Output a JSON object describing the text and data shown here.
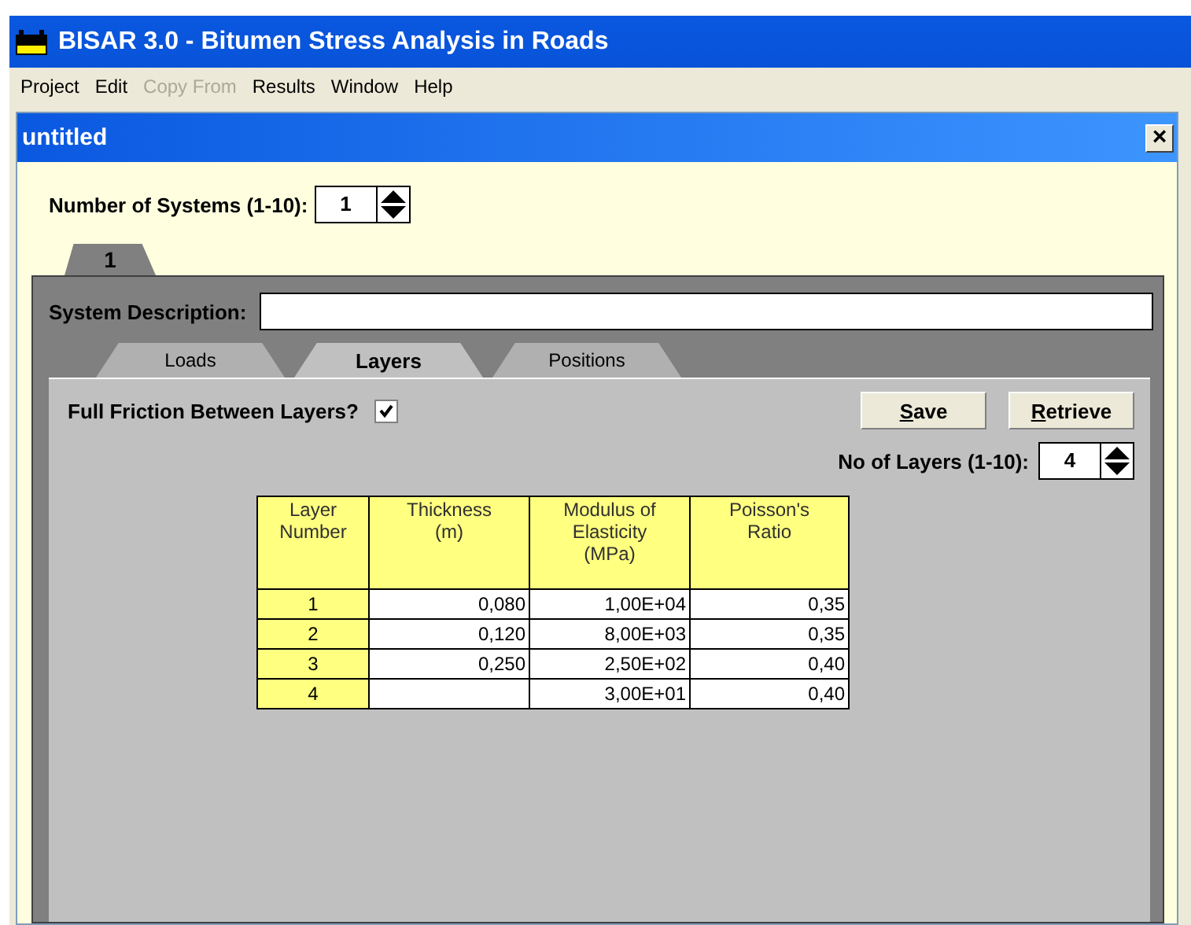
{
  "window": {
    "title": "BISAR 3.0 - Bitumen Stress Analysis in Roads"
  },
  "menu": [
    {
      "label": "Project",
      "disabled": false
    },
    {
      "label": "Edit",
      "disabled": false
    },
    {
      "label": "Copy From",
      "disabled": true
    },
    {
      "label": "Results",
      "disabled": false
    },
    {
      "label": "Window",
      "disabled": false
    },
    {
      "label": "Help",
      "disabled": false
    }
  ],
  "document": {
    "title": "untitled",
    "close": "×"
  },
  "systems": {
    "label": "Number of Systems (1-10):",
    "value": "1"
  },
  "system_tabs": [
    {
      "label": "1",
      "selected": true
    }
  ],
  "description": {
    "label": "System Description:"
  },
  "tabs": [
    {
      "label": "Loads",
      "selected": false
    },
    {
      "label": "Layers",
      "selected": true
    },
    {
      "label": "Positions",
      "selected": false
    }
  ],
  "friction": {
    "label": "Full Friction Between Layers?",
    "checked": true
  },
  "buttons": [
    "Save",
    "Retrieve"
  ],
  "layers_count": {
    "label": "No of Layers (1-10):",
    "value": "4"
  },
  "table": {
    "columns": [
      "Layer\nNumber",
      "Thickness\n(m)",
      "Modulus of\nElasticity\n(MPa)",
      "Poisson's\nRatio"
    ],
    "rows": [
      [
        "1",
        "0,080",
        "1,00E+04",
        "0,35"
      ],
      [
        "2",
        "0,120",
        "8,00E+03",
        "0,35"
      ],
      [
        "3",
        "0,250",
        "2,50E+02",
        "0,40"
      ],
      [
        "4",
        "",
        "3,00E+01",
        "0,40"
      ]
    ]
  }
}
